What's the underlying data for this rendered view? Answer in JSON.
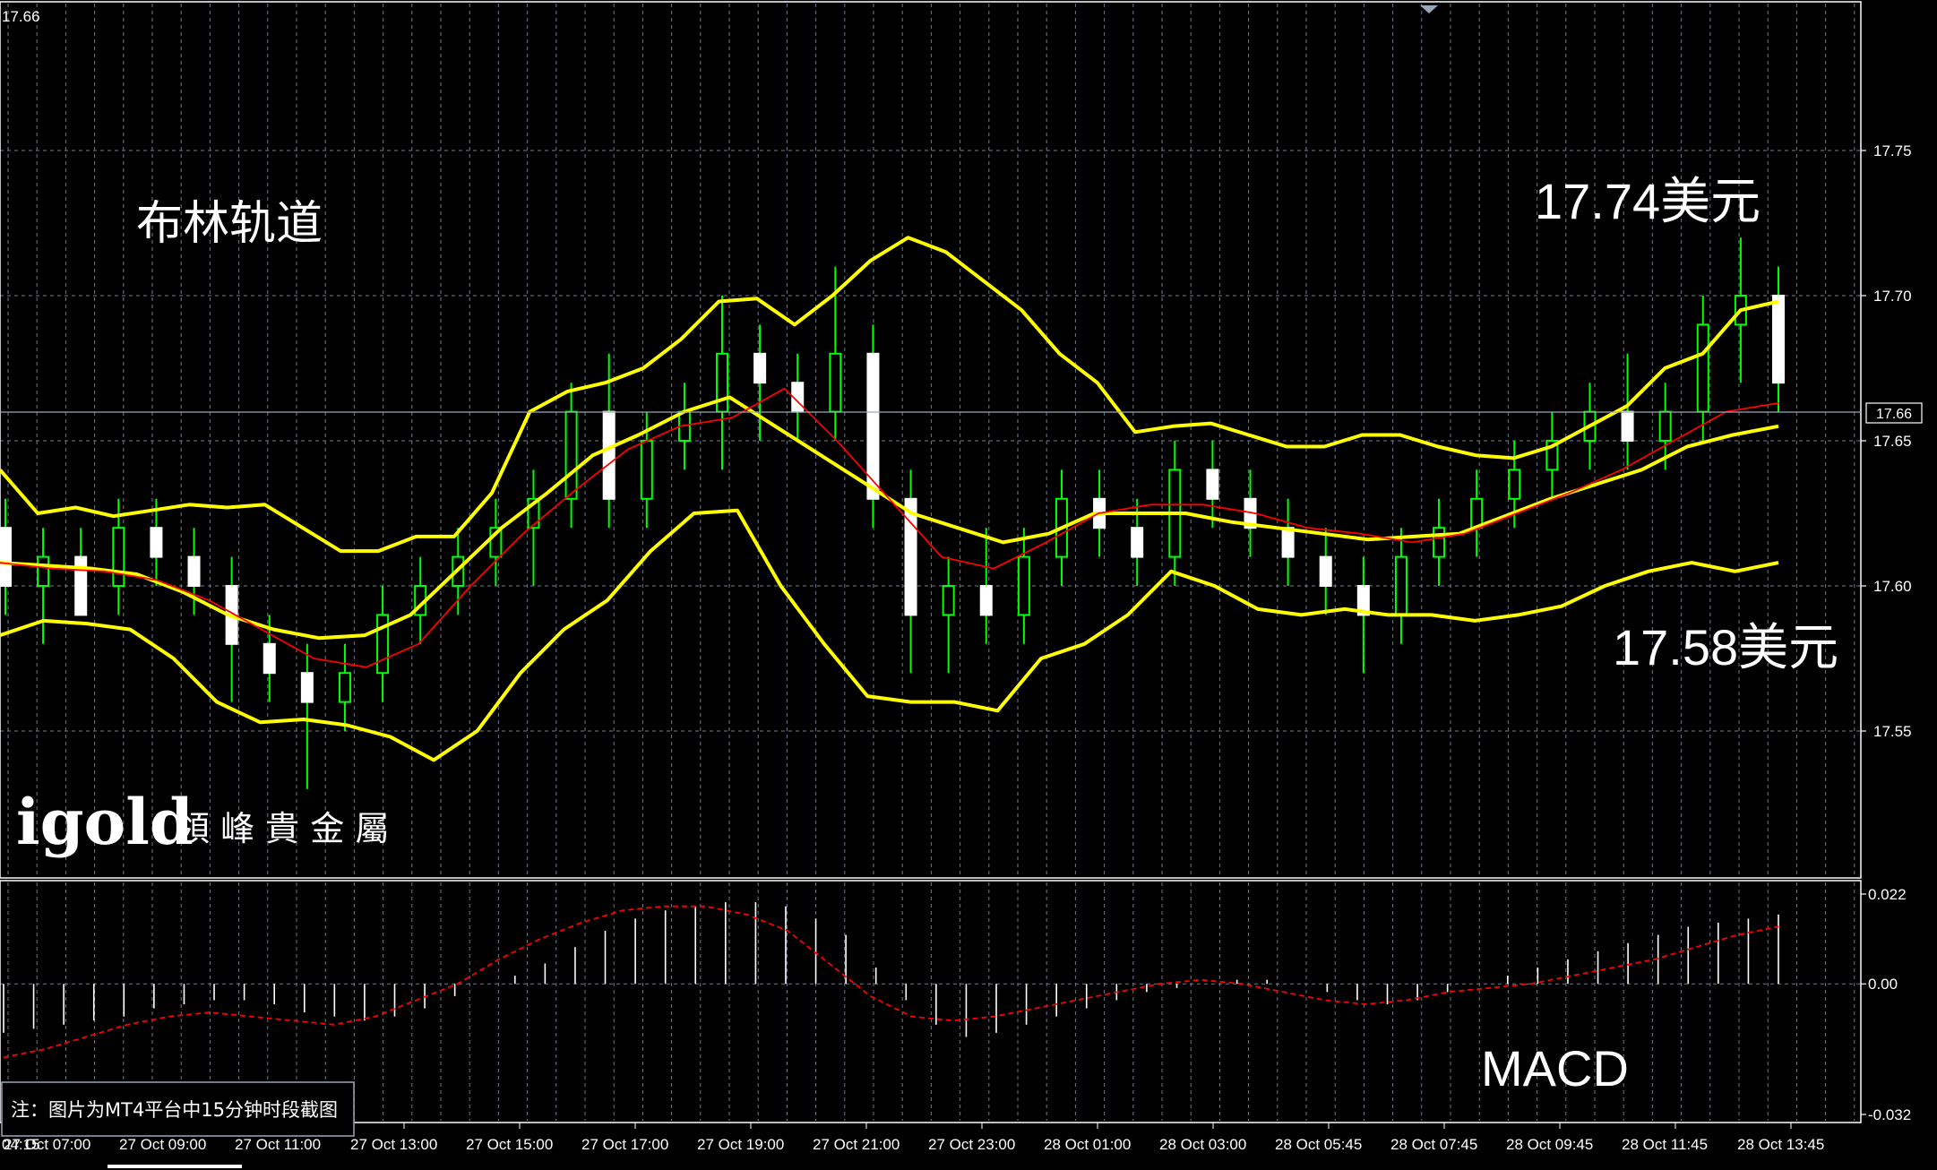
{
  "platform_note": "注：图片为MT4平台中15分钟时段截图",
  "logo": {
    "brand": "igold",
    "name_cn": "領 峰 貴 金 屬"
  },
  "colors": {
    "background": "#000000",
    "grid": "#6e7b8b",
    "candle_up": "#ffffff",
    "candle_wick": "#00ff00",
    "bollinger": "#ffff00",
    "moving_average": "#ff0000",
    "macd_hist": "#ffffff",
    "macd_signal": "#ff0000"
  },
  "chart_data": [
    {
      "type": "candlestick",
      "title": "布林轨道",
      "top_left_value": "17.66",
      "current_price_label": "17.66",
      "annotations": [
        "17.74美元",
        "17.58美元"
      ],
      "x_tick_labels": [
        "04:15",
        "27 Oct 07:00",
        "27 Oct 09:00",
        "27 Oct 11:00",
        "27 Oct 13:00",
        "27 Oct 15:00",
        "27 Oct 17:00",
        "27 Oct 19:00",
        "27 Oct 21:00",
        "27 Oct 23:00",
        "28 Oct 01:00",
        "28 Oct 03:00",
        "28 Oct 05:45",
        "28 Oct 07:45",
        "28 Oct 09:45",
        "28 Oct 11:45",
        "28 Oct 13:45"
      ],
      "y_tick_labels": [
        "17.75",
        "17.70",
        "17.65",
        "17.60",
        "17.55"
      ],
      "ylim": [
        17.51,
        17.77
      ],
      "grid": true,
      "indicators": [
        "Bollinger Bands",
        "Moving Average"
      ],
      "bollinger_upper": [
        17.64,
        17.625,
        17.627,
        17.624,
        17.626,
        17.628,
        17.627,
        17.628,
        17.62,
        17.612,
        17.612,
        17.617,
        17.617,
        17.632,
        17.66,
        17.667,
        17.67,
        17.675,
        17.685,
        17.698,
        17.699,
        17.69,
        17.7,
        17.712,
        17.72,
        17.715,
        17.705,
        17.695,
        17.68,
        17.67,
        17.653,
        17.655,
        17.656,
        17.652,
        17.648,
        17.648,
        17.652,
        17.652,
        17.648,
        17.645,
        17.644,
        17.648,
        17.655,
        17.662,
        17.675,
        17.68,
        17.695,
        17.698
      ],
      "bollinger_middle": [
        17.608,
        17.607,
        17.606,
        17.604,
        17.598,
        17.59,
        17.585,
        17.582,
        17.583,
        17.59,
        17.605,
        17.62,
        17.632,
        17.645,
        17.652,
        17.66,
        17.665,
        17.655,
        17.645,
        17.635,
        17.625,
        17.62,
        17.615,
        17.618,
        17.625,
        17.625,
        17.625,
        17.622,
        17.62,
        17.618,
        17.616,
        17.617,
        17.618,
        17.624,
        17.63,
        17.635,
        17.64,
        17.648,
        17.652,
        17.655
      ],
      "bollinger_lower": [
        17.583,
        17.588,
        17.587,
        17.585,
        17.575,
        17.56,
        17.553,
        17.554,
        17.552,
        17.548,
        17.54,
        17.55,
        17.57,
        17.585,
        17.595,
        17.612,
        17.625,
        17.626,
        17.6,
        17.58,
        17.562,
        17.56,
        17.56,
        17.557,
        17.575,
        17.58,
        17.59,
        17.605,
        17.6,
        17.592,
        17.59,
        17.592,
        17.59,
        17.59,
        17.588,
        17.59,
        17.593,
        17.6,
        17.605,
        17.608,
        17.605,
        17.608
      ],
      "moving_average": [
        17.608,
        17.606,
        17.605,
        17.602,
        17.595,
        17.585,
        17.575,
        17.572,
        17.58,
        17.6,
        17.618,
        17.633,
        17.647,
        17.655,
        17.658,
        17.668,
        17.65,
        17.63,
        17.61,
        17.606,
        17.615,
        17.625,
        17.628,
        17.628,
        17.625,
        17.62,
        17.618,
        17.615,
        17.618,
        17.625,
        17.632,
        17.64,
        17.65,
        17.66,
        17.663
      ],
      "candles_ohlc": [
        [
          17.62,
          17.63,
          17.59,
          17.6
        ],
        [
          17.6,
          17.62,
          17.58,
          17.61
        ],
        [
          17.61,
          17.62,
          17.59,
          17.59
        ],
        [
          17.6,
          17.63,
          17.59,
          17.62
        ],
        [
          17.62,
          17.63,
          17.6,
          17.61
        ],
        [
          17.61,
          17.62,
          17.59,
          17.6
        ],
        [
          17.6,
          17.61,
          17.56,
          17.58
        ],
        [
          17.58,
          17.59,
          17.56,
          17.57
        ],
        [
          17.57,
          17.58,
          17.53,
          17.56
        ],
        [
          17.56,
          17.58,
          17.55,
          17.57
        ],
        [
          17.57,
          17.6,
          17.56,
          17.59
        ],
        [
          17.59,
          17.61,
          17.58,
          17.6
        ],
        [
          17.6,
          17.62,
          17.59,
          17.61
        ],
        [
          17.61,
          17.63,
          17.6,
          17.62
        ],
        [
          17.62,
          17.64,
          17.6,
          17.63
        ],
        [
          17.63,
          17.67,
          17.62,
          17.66
        ],
        [
          17.66,
          17.68,
          17.62,
          17.63
        ],
        [
          17.63,
          17.66,
          17.62,
          17.65
        ],
        [
          17.65,
          17.67,
          17.64,
          17.66
        ],
        [
          17.66,
          17.7,
          17.64,
          17.68
        ],
        [
          17.68,
          17.69,
          17.65,
          17.67
        ],
        [
          17.67,
          17.68,
          17.65,
          17.66
        ],
        [
          17.66,
          17.71,
          17.65,
          17.68
        ],
        [
          17.68,
          17.69,
          17.62,
          17.63
        ],
        [
          17.63,
          17.64,
          17.57,
          17.59
        ],
        [
          17.59,
          17.61,
          17.57,
          17.6
        ],
        [
          17.6,
          17.62,
          17.58,
          17.59
        ],
        [
          17.59,
          17.62,
          17.58,
          17.61
        ],
        [
          17.61,
          17.64,
          17.6,
          17.63
        ],
        [
          17.63,
          17.64,
          17.61,
          17.62
        ],
        [
          17.62,
          17.63,
          17.6,
          17.61
        ],
        [
          17.61,
          17.65,
          17.6,
          17.64
        ],
        [
          17.64,
          17.65,
          17.62,
          17.63
        ],
        [
          17.63,
          17.64,
          17.61,
          17.62
        ],
        [
          17.62,
          17.63,
          17.6,
          17.61
        ],
        [
          17.61,
          17.62,
          17.59,
          17.6
        ],
        [
          17.6,
          17.61,
          17.57,
          17.59
        ],
        [
          17.59,
          17.62,
          17.58,
          17.61
        ],
        [
          17.61,
          17.63,
          17.6,
          17.62
        ],
        [
          17.62,
          17.64,
          17.61,
          17.63
        ],
        [
          17.63,
          17.65,
          17.62,
          17.64
        ],
        [
          17.64,
          17.66,
          17.63,
          17.65
        ],
        [
          17.65,
          17.67,
          17.64,
          17.66
        ],
        [
          17.66,
          17.68,
          17.64,
          17.65
        ],
        [
          17.65,
          17.67,
          17.64,
          17.66
        ],
        [
          17.66,
          17.7,
          17.65,
          17.69
        ],
        [
          17.69,
          17.72,
          17.67,
          17.7
        ],
        [
          17.7,
          17.71,
          17.66,
          17.67
        ]
      ]
    },
    {
      "type": "bar",
      "title": "MACD",
      "y_tick_labels": [
        "0.022",
        "0.00",
        "-0.032"
      ],
      "ylim": [
        -0.032,
        0.022
      ],
      "grid": true,
      "histogram": [
        -0.012,
        -0.011,
        -0.01,
        -0.009,
        -0.008,
        -0.006,
        -0.005,
        -0.004,
        -0.004,
        -0.005,
        -0.007,
        -0.008,
        -0.009,
        -0.008,
        -0.006,
        -0.003,
        0.0,
        0.002,
        0.005,
        0.009,
        0.013,
        0.016,
        0.018,
        0.019,
        0.02,
        0.02,
        0.019,
        0.016,
        0.012,
        0.004,
        -0.004,
        -0.01,
        -0.013,
        -0.012,
        -0.01,
        -0.008,
        -0.006,
        -0.004,
        -0.002,
        -0.001,
        0.0,
        0.001,
        0.001,
        0.0,
        -0.002,
        -0.004,
        -0.005,
        -0.004,
        -0.002,
        0.0,
        0.002,
        0.004,
        0.006,
        0.008,
        0.01,
        0.012,
        0.014,
        0.015,
        0.016,
        0.017
      ],
      "signal": [
        -0.018,
        -0.016,
        -0.013,
        -0.01,
        -0.008,
        -0.007,
        -0.008,
        -0.009,
        -0.01,
        -0.008,
        -0.004,
        0.0,
        0.006,
        0.011,
        0.015,
        0.018,
        0.019,
        0.019,
        0.017,
        0.013,
        0.005,
        -0.003,
        -0.008,
        -0.009,
        -0.008,
        -0.006,
        -0.004,
        -0.002,
        0.0,
        0.001,
        0.0,
        -0.002,
        -0.004,
        -0.005,
        -0.004,
        -0.002,
        -0.001,
        0.0,
        0.002,
        0.004,
        0.006,
        0.009,
        0.012,
        0.014
      ]
    }
  ]
}
